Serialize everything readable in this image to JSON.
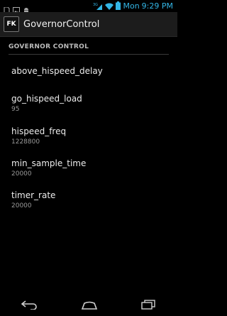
{
  "status_bar": {
    "notification_icons": [
      "sd-card-icon",
      "image-icon",
      "android-icon"
    ],
    "day": "Mon",
    "time": "9:29",
    "time_suffix": "PM",
    "network": "3G",
    "icons": [
      "signal-icon",
      "wifi-icon",
      "battery-icon"
    ],
    "accent_color": "#33b5e5"
  },
  "action_bar": {
    "app_icon_text": "FK",
    "title": "GovernorControl"
  },
  "section": {
    "header": "GOVERNOR CONTROL"
  },
  "preferences": [
    {
      "title": "above_hispeed_delay",
      "summary": ""
    },
    {
      "title": "go_hispeed_load",
      "summary": "95"
    },
    {
      "title": "hispeed_freq",
      "summary": "1228800"
    },
    {
      "title": "min_sample_time",
      "summary": "20000"
    },
    {
      "title": "timer_rate",
      "summary": "20000"
    }
  ],
  "nav_bar": {
    "icons": [
      "back-icon",
      "home-icon",
      "recent-apps-icon"
    ]
  }
}
